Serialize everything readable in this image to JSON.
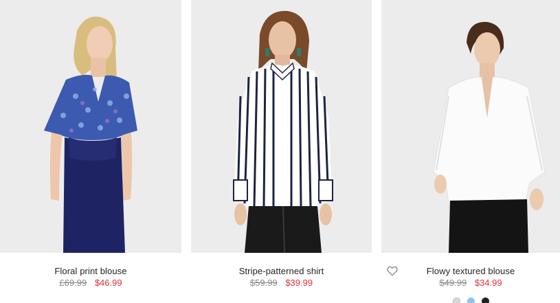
{
  "products": [
    {
      "name": "Floral print blouse",
      "old_price": "£69.99",
      "new_price": "$46.99",
      "image": "model-in-floral-blouse"
    },
    {
      "name": "Stripe-patterned shirt",
      "old_price": "$59.99",
      "new_price": "$39.99",
      "image": "model-in-striped-shirt"
    },
    {
      "name": "Flowy textured blouse",
      "old_price": "$49.99",
      "new_price": "$34.99",
      "image": "model-in-white-blouse",
      "wishlist_icon": "heart-outline-icon",
      "color_swatches": [
        {
          "name": "light-grey",
          "color": "#d9d9d9"
        },
        {
          "name": "light-blue",
          "color": "#8fc3ee"
        },
        {
          "name": "black",
          "color": "#222222"
        }
      ]
    }
  ],
  "colors": {
    "sale_price": "#e0303a",
    "old_price": "#888888",
    "photo_background": "#ececec"
  }
}
